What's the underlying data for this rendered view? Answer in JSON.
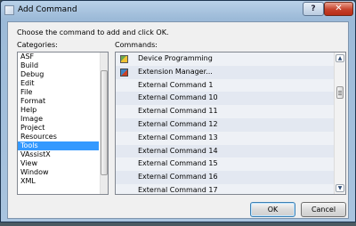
{
  "window": {
    "title": "Add Command",
    "help_label": "?",
    "close_label": "✕"
  },
  "dialog": {
    "instruction": "Choose the command to add and click OK.",
    "categories_label": "Categories:",
    "commands_label": "Commands:"
  },
  "categories": {
    "items": [
      "ASF",
      "Build",
      "Debug",
      "Edit",
      "File",
      "Format",
      "Help",
      "Image",
      "Project",
      "Resources",
      "Tools",
      "VAssistX",
      "View",
      "Window",
      "XML"
    ],
    "selected": "Tools"
  },
  "commands": {
    "items": [
      {
        "label": "Device Programming",
        "icon": "device-programming-icon"
      },
      {
        "label": "Extension Manager...",
        "icon": "extension-manager-icon"
      },
      {
        "label": "External Command 1",
        "icon": ""
      },
      {
        "label": "External Command 10",
        "icon": ""
      },
      {
        "label": "External Command 11",
        "icon": ""
      },
      {
        "label": "External Command 12",
        "icon": ""
      },
      {
        "label": "External Command 13",
        "icon": ""
      },
      {
        "label": "External Command 14",
        "icon": ""
      },
      {
        "label": "External Command 15",
        "icon": ""
      },
      {
        "label": "External Command 16",
        "icon": ""
      },
      {
        "label": "External Command 17",
        "icon": ""
      }
    ]
  },
  "buttons": {
    "ok_label": "OK",
    "cancel_label": "Cancel"
  },
  "colors": {
    "selection": "#3399ff",
    "title_bar": "#9cbad8",
    "close_button": "#c6412a"
  }
}
